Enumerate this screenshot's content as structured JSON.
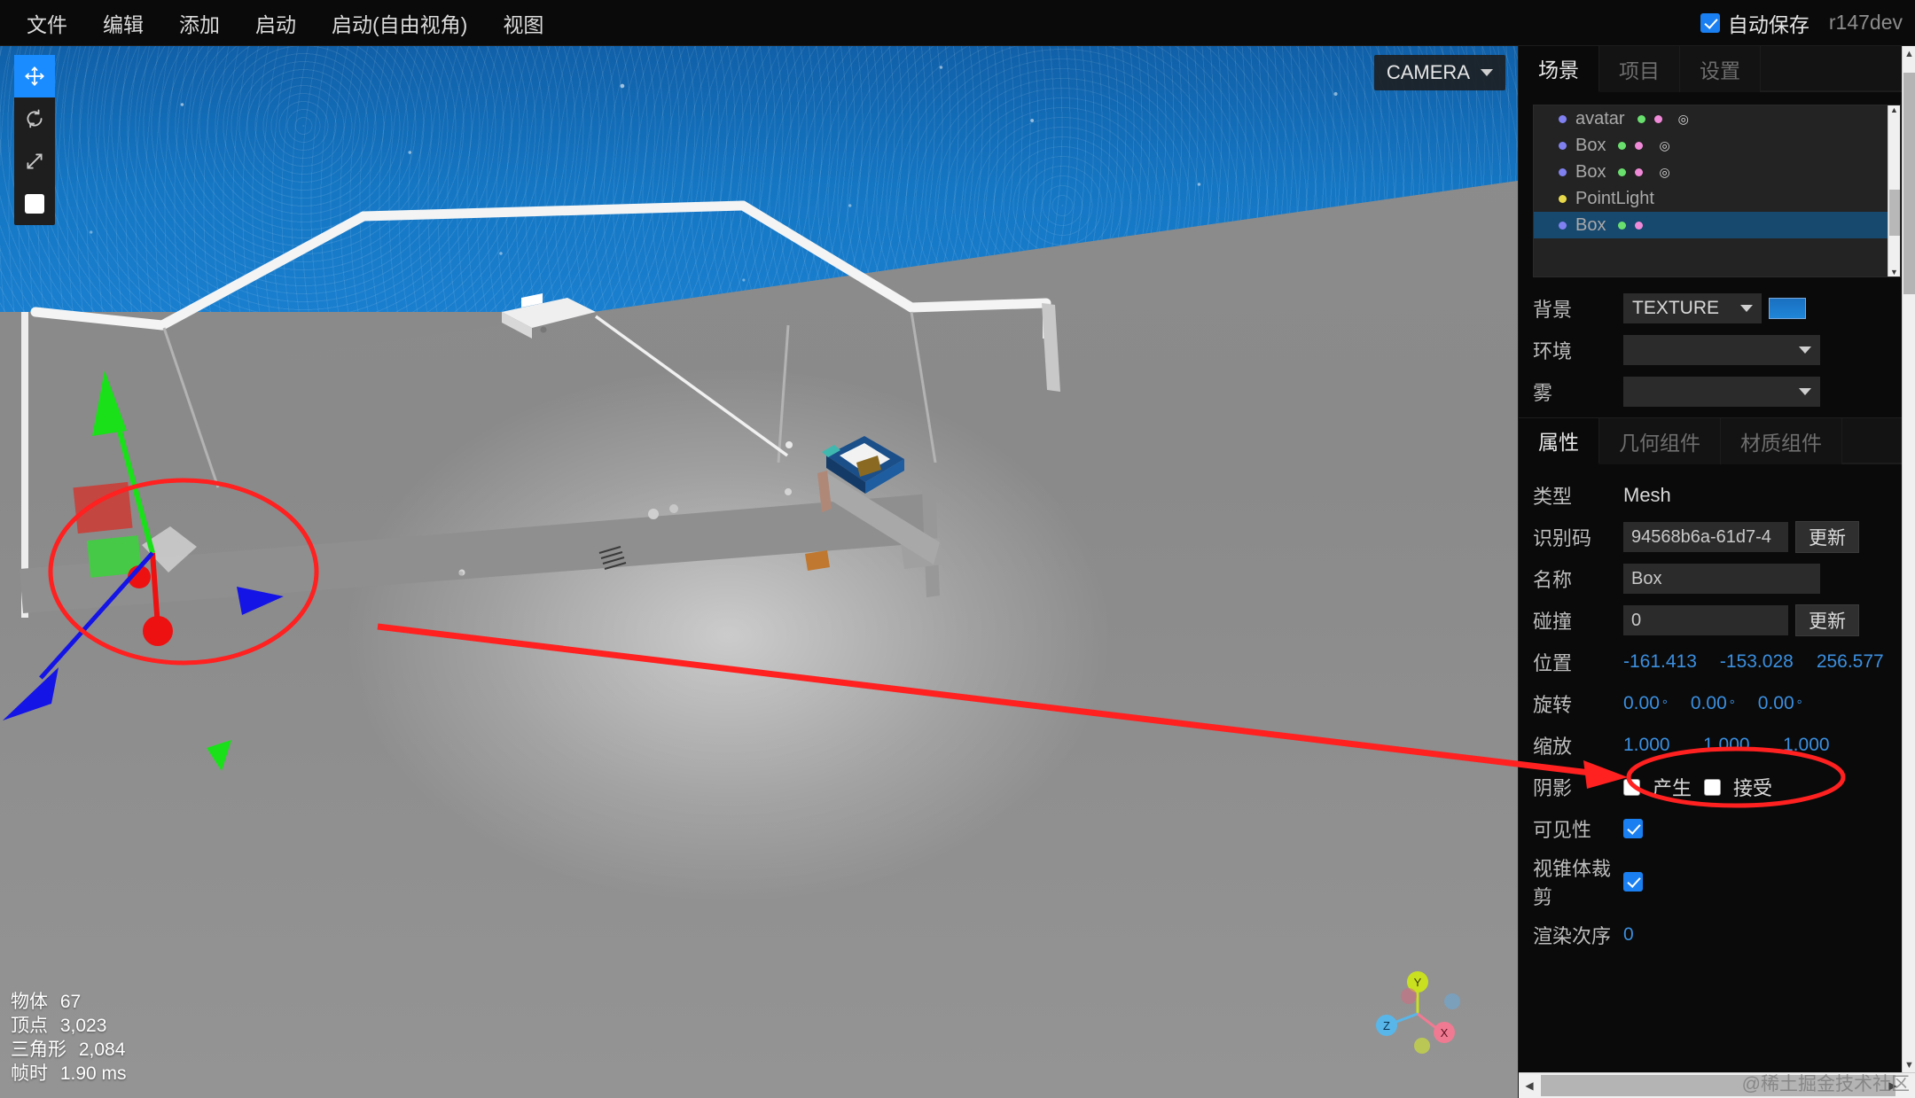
{
  "menubar": {
    "items": [
      {
        "label": "文件",
        "name": "menu-file"
      },
      {
        "label": "编辑",
        "name": "menu-edit"
      },
      {
        "label": "添加",
        "name": "menu-add"
      },
      {
        "label": "启动",
        "name": "menu-play"
      },
      {
        "label": "启动(自由视角)",
        "name": "menu-play-free-camera"
      },
      {
        "label": "视图",
        "name": "menu-view"
      }
    ],
    "autosave_label": "自动保存",
    "autosave_checked": true,
    "version": "r147dev"
  },
  "viewport": {
    "camera_label": "CAMERA",
    "tools": [
      {
        "name": "translate-tool",
        "icon": "move-icon",
        "active": true
      },
      {
        "name": "rotate-tool",
        "icon": "rotate-icon",
        "active": false
      },
      {
        "name": "scale-tool",
        "icon": "scale-icon",
        "active": false
      },
      {
        "name": "grid-toggle",
        "icon": "square-icon",
        "active": false
      }
    ],
    "stats": [
      {
        "label": "物体",
        "value": "67"
      },
      {
        "label": "顶点",
        "value": "3,023"
      },
      {
        "label": "三角形",
        "value": "2,084"
      },
      {
        "label": "帧时",
        "value": "1.90 ms"
      }
    ],
    "axis_gizmo": {
      "x": "X",
      "y": "Y",
      "z": "Z"
    }
  },
  "panel": {
    "top_tabs": [
      {
        "label": "场景",
        "name": "tab-scene",
        "active": true
      },
      {
        "label": "项目",
        "name": "tab-project",
        "active": false
      },
      {
        "label": "设置",
        "name": "tab-settings",
        "active": false
      }
    ],
    "outliner": [
      {
        "label": "avatar",
        "type": "mesh",
        "selected": false,
        "has_texture": true
      },
      {
        "label": "Box",
        "type": "mesh",
        "selected": false,
        "has_texture": true
      },
      {
        "label": "Box",
        "type": "mesh",
        "selected": false,
        "has_texture": true
      },
      {
        "label": "PointLight",
        "type": "light",
        "selected": false,
        "has_texture": false
      },
      {
        "label": "Box",
        "type": "mesh",
        "selected": true,
        "has_texture": false
      }
    ],
    "scene_props": [
      {
        "label": "背景",
        "name": "background",
        "value": "TEXTURE",
        "has_swatch": true
      },
      {
        "label": "环境",
        "name": "environment",
        "value": "",
        "has_swatch": false
      },
      {
        "label": "雾",
        "name": "fog",
        "value": "",
        "has_swatch": false
      }
    ],
    "object_tabs": [
      {
        "label": "属性",
        "name": "tab-object-properties",
        "active": true
      },
      {
        "label": "几何组件",
        "name": "tab-geometry",
        "active": false
      },
      {
        "label": "材质组件",
        "name": "tab-material",
        "active": false
      }
    ],
    "object": {
      "type_label": "类型",
      "type_value": "Mesh",
      "uuid_label": "识别码",
      "uuid_value": "94568b6a-61d7-4",
      "uuid_button": "更新",
      "name_label": "名称",
      "name_value": "Box",
      "collision_label": "碰撞",
      "collision_value": "0",
      "collision_button": "更新",
      "position_label": "位置",
      "position": [
        "-161.413",
        "-153.028",
        "256.577"
      ],
      "rotation_label": "旋转",
      "rotation": [
        "0.00",
        "0.00",
        "0.00"
      ],
      "rotation_unit": "°",
      "scale_label": "缩放",
      "scale": [
        "1.000",
        "1.000",
        "1.000"
      ],
      "shadow_label": "阴影",
      "shadow_cast_label": "产生",
      "shadow_cast_checked": false,
      "shadow_receive_label": "接受",
      "shadow_receive_checked": false,
      "visible_label": "可见性",
      "visible_checked": true,
      "frustum_label": "视锥体裁剪",
      "frustum_checked": true,
      "render_order_label": "渲染次序",
      "render_order_value": "0"
    }
  },
  "watermark": "@稀土掘金技术社区",
  "colors": {
    "accent_blue": "#1a8cff",
    "selection_blue": "#17486e",
    "value_blue": "#3b8fe0",
    "annotation_red": "#ff2020",
    "panel_bg": "#0a0a0a"
  }
}
